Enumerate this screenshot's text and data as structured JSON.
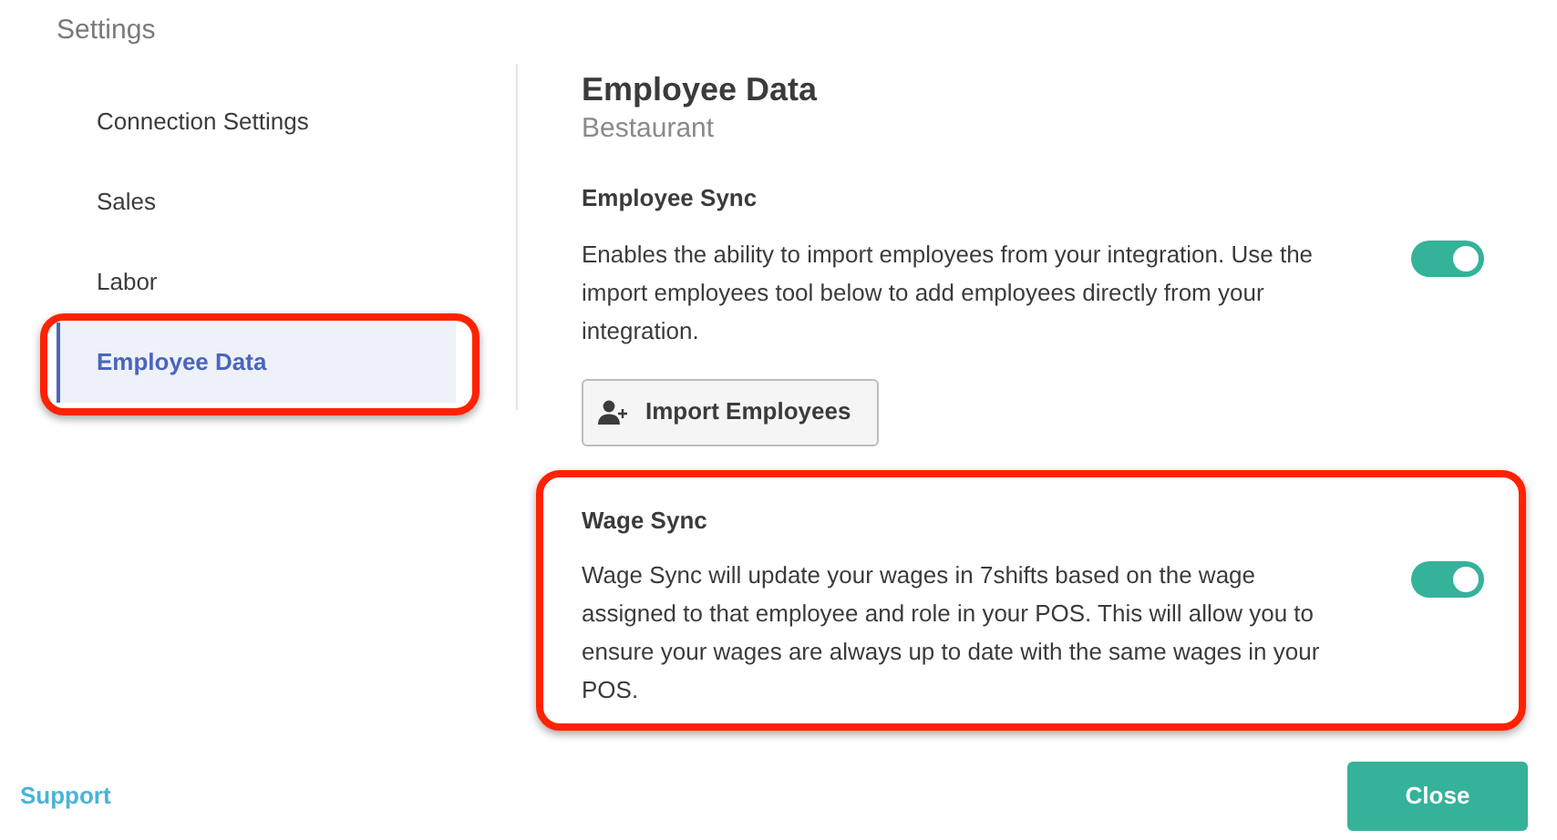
{
  "header": {
    "title": "Settings"
  },
  "sidebar": {
    "items": [
      {
        "label": "Connection Settings",
        "selected": false,
        "highlighted": false
      },
      {
        "label": "Sales",
        "selected": false,
        "highlighted": false
      },
      {
        "label": "Labor",
        "selected": false,
        "highlighted": false
      },
      {
        "label": "Employee Data",
        "selected": true,
        "highlighted": true
      }
    ]
  },
  "content": {
    "title": "Employee Data",
    "subtitle": "Bestaurant",
    "sections": [
      {
        "title": "Employee Sync",
        "description": "Enables the ability to import employees from your integration. Use the import employees tool below to add employees directly from your integration.",
        "on": true,
        "highlighted": false,
        "button": "Import Employees"
      },
      {
        "title": "Wage Sync",
        "description": "Wage Sync will update your wages in 7shifts based on the wage assigned to that employee and role in your POS. This will allow you to ensure your wages are always up to date with the same wages in your POS.",
        "on": true,
        "highlighted": true
      }
    ]
  },
  "footer": {
    "link": "Support",
    "button": "Close"
  }
}
